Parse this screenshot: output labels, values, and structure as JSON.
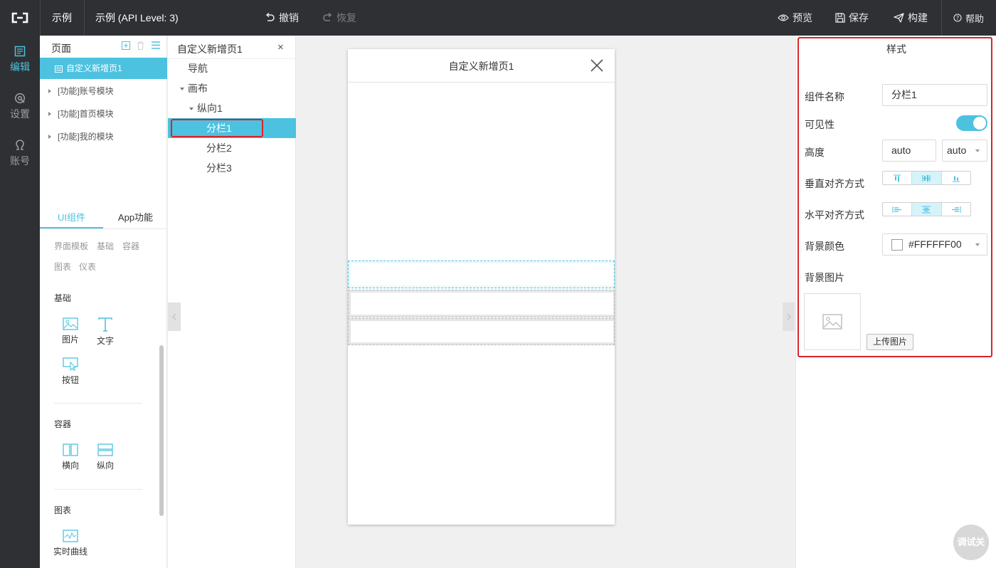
{
  "topbar": {
    "app_name": "示例",
    "project_title": "示例 (API Level: 3)",
    "undo_label": "撤销",
    "redo_label": "恢复",
    "preview_label": "预览",
    "save_label": "保存",
    "build_label": "构建",
    "help_label": "帮助"
  },
  "leftnav": {
    "items": [
      {
        "label": "编辑",
        "icon": "edit-icon"
      },
      {
        "label": "设置",
        "icon": "settings-icon"
      },
      {
        "label": "账号",
        "icon": "account-icon"
      }
    ]
  },
  "pages": {
    "title": "页面",
    "items": [
      {
        "label": "自定义新增页1"
      },
      {
        "label": "[功能]账号模块"
      },
      {
        "label": "[功能]首页模块"
      },
      {
        "label": "[功能]我的模块"
      }
    ]
  },
  "components": {
    "tabs": [
      "UI组件",
      "App功能"
    ],
    "filters": [
      "界面模板",
      "基础",
      "容器",
      "图表",
      "仪表"
    ],
    "sections": {
      "basic": {
        "title": "基础",
        "items": [
          "图片",
          "文字",
          "按钮"
        ]
      },
      "container": {
        "title": "容器",
        "items": [
          "横向",
          "纵向"
        ]
      },
      "chart": {
        "title": "图表",
        "items": [
          "实时曲线"
        ]
      }
    }
  },
  "tree": {
    "title": "自定义新增页1",
    "close": "×",
    "nodes": [
      "导航",
      "画布",
      "纵向1",
      "分栏1",
      "分栏2",
      "分栏3"
    ]
  },
  "canvas": {
    "page_title": "自定义新增页1"
  },
  "style_panel": {
    "title": "样式",
    "name_label": "组件名称",
    "name_value": "分栏1",
    "visibility_label": "可见性",
    "visible": true,
    "height_label": "高度",
    "height_value": "auto",
    "height_unit": "auto",
    "valign_label": "垂直对齐方式",
    "halign_label": "水平对齐方式",
    "bgcolor_label": "背景颜色",
    "bgcolor_value": "#FFFFFF00",
    "bgimage_label": "背景图片",
    "upload_label": "上传图片"
  },
  "debug": {
    "label": "调试关"
  },
  "colors": {
    "accent": "#4cc2e0",
    "dark": "#2f3033",
    "highlight": "#d8232a"
  }
}
